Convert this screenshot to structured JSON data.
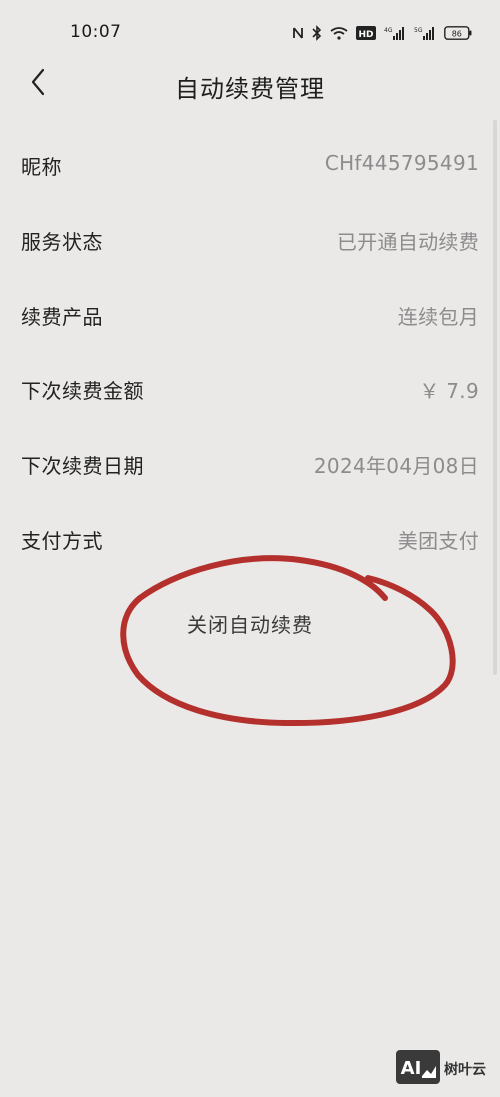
{
  "status_bar": {
    "time": "10:07",
    "battery": "86",
    "icons": [
      "nfc-icon",
      "bluetooth-icon",
      "wifi-icon",
      "hd-icon",
      "signal-4g-icon",
      "signal-5g-icon",
      "battery-icon"
    ]
  },
  "header": {
    "title": "自动续费管理"
  },
  "rows": [
    {
      "label": "昵称",
      "value": "CHf445795491"
    },
    {
      "label": "服务状态",
      "value": "已开通自动续费"
    },
    {
      "label": "续费产品",
      "value": "连续包月"
    },
    {
      "label": "下次续费金额",
      "value": "￥ 7.9"
    },
    {
      "label": "下次续费日期",
      "value": "2024年04月08日"
    },
    {
      "label": "支付方式",
      "value": "美团支付"
    }
  ],
  "actions": {
    "close_renewal_label": "关闭自动续费"
  },
  "annotation": {
    "color": "#b4302c"
  },
  "watermark": {
    "logo_text": "AI",
    "text": "树叶云"
  }
}
